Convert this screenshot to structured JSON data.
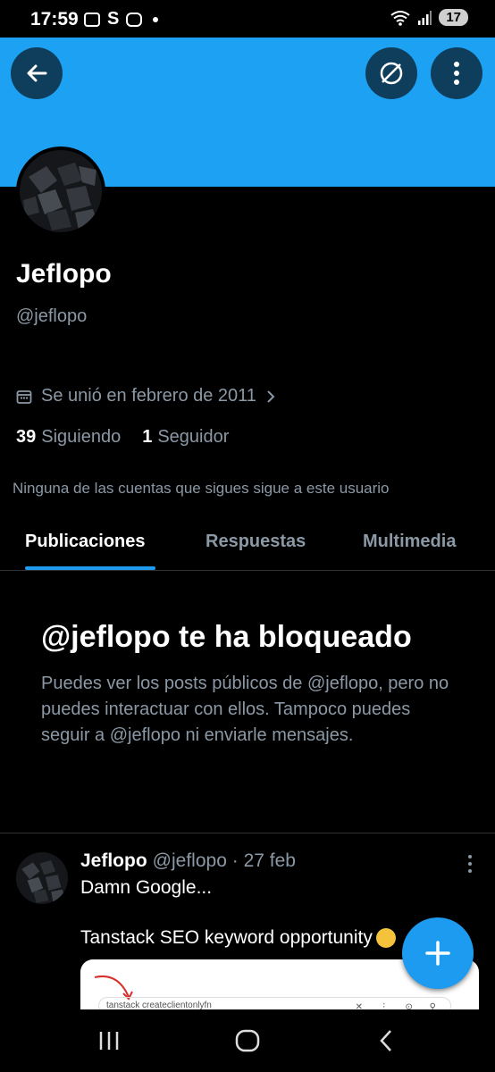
{
  "status_bar": {
    "time": "17:59",
    "s_label": "S",
    "battery": "17"
  },
  "profile": {
    "name": "Jeflopo",
    "handle": "@jeflopo",
    "joined": "Se unió en febrero de 2011",
    "following_count": "39",
    "following_label": "Siguiendo",
    "followers_count": "1",
    "followers_label": "Seguidor",
    "mutual_text": "Ninguna de las cuentas que sigues sigue a este usuario"
  },
  "tabs": [
    {
      "label": "Publicaciones",
      "active": true
    },
    {
      "label": "Respuestas",
      "active": false
    },
    {
      "label": "Multimedia",
      "active": false
    }
  ],
  "blocked": {
    "title": "@jeflopo te ha bloqueado",
    "body": "Puedes ver los posts públicos de @jeflopo, pero no puedes interactuar con ellos. Tampoco puedes seguir a @jeflopo ni enviarle mensajes."
  },
  "post": {
    "author": "Jeflopo",
    "handle": "@jeflopo",
    "separator": "·",
    "date": "27 feb",
    "line1": "Damn Google...",
    "line2": "Tanstack SEO keyword opportunity",
    "image_search_text": "tanstack createclientonlyfn"
  },
  "colors": {
    "banner": "#1da1f2",
    "accent": "#1d9bf0",
    "background": "#000000",
    "secondary_text": "#8b98a5"
  },
  "icons": {
    "back": "arrow-left-icon",
    "explore": "compass-icon",
    "more": "more-vertical-icon",
    "calendar": "calendar-icon",
    "chevron": "chevron-right-icon",
    "compose": "plus-icon",
    "nav_recents": "recents-icon",
    "nav_home": "home-icon",
    "nav_back": "nav-back-icon"
  }
}
